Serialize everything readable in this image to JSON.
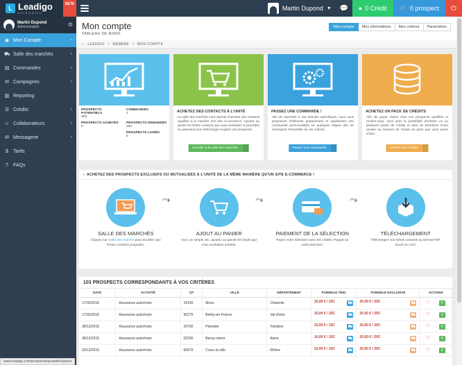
{
  "topbar": {
    "logo_text": "Leadigo",
    "logo_sub": "B to B & B to C",
    "beta": "BETA",
    "user_name": "Martin Dupond",
    "credit_label": "0 Crédit",
    "prospect_label": "0 prospect"
  },
  "sidebar": {
    "user_name": "Martin Dupond",
    "user_role": "Administration",
    "items": [
      {
        "label": "Mon Compte",
        "icon": "dashboard-icon",
        "glyph": "◉",
        "chevron": true
      },
      {
        "label": "Salle des marchés",
        "icon": "cart-icon",
        "glyph": "⛟",
        "chevron": true
      },
      {
        "label": "Commandes",
        "icon": "file-icon",
        "glyph": "▤",
        "chevron": true
      },
      {
        "label": "Campagnes",
        "icon": "mail-icon",
        "glyph": "✉",
        "chevron": true
      },
      {
        "label": "Reporting",
        "icon": "chart-icon",
        "glyph": "▥",
        "chevron": false
      },
      {
        "label": "Crédits",
        "icon": "list-icon",
        "glyph": "☰",
        "chevron": true
      },
      {
        "label": "Collaborateurs",
        "icon": "users-icon",
        "glyph": "☺",
        "chevron": true
      },
      {
        "label": "Messagerie",
        "icon": "envelope-icon",
        "glyph": "✉",
        "chevron": true
      },
      {
        "label": "Tarifs",
        "icon": "tag-icon",
        "glyph": "$",
        "chevron": false
      },
      {
        "label": "FAQs",
        "icon": "question-icon",
        "glyph": "?",
        "chevron": false
      }
    ]
  },
  "header": {
    "title": "Mon compte",
    "subtitle": "TABLEAU DE BORD",
    "tabs": [
      "Mon compte",
      "Mes informations",
      "Mes critères",
      "Paramètres"
    ]
  },
  "breadcrumb": [
    "LEADIGO",
    "MEMBRE",
    "MON COMPTE"
  ],
  "stats": {
    "labels": [
      "PROSPECTS POTENTIELS",
      "COMMANDES",
      "PROSPECTS ACHETÉS",
      "PROSPECTS DEMANDÉS",
      "PROSPECTS LIVRÉS"
    ],
    "values": [
      "103",
      "1",
      "0",
      "150",
      "0"
    ]
  },
  "cards": [
    {
      "title": "ACHETEZ DES CONTACTS À L'UNITÉ",
      "text": "La salle des marchés vous permet d'acheter des contacts qualifiés à la manière d'un site e-commerce. Ajoutez au panier les fiches contacts que vous souhaitez et procédez au paiement pour télécharger et gérer vos prospects.",
      "button": "Accéder à la salle des marchés",
      "color": "#5cb85c"
    },
    {
      "title": "PASSEZ UNE COMMANDE !",
      "text": "Afin de répondre à vos besoins spécifiques, nous vous proposons d'effectuer gratuitement et rapidement une commande personnalisée en quelques étapes afin de renseigner l'ensemble de vos critères.",
      "button": "Passer une commande",
      "color": "#3aa2dc"
    },
    {
      "title": "ACHETEZ UN PACK DE CRÉDITS",
      "text": "Afin de payer moins cher vos prospects qualifiés et rendez-vous, vous avez la possibilité d'acheter un ou plusieurs packs de crédits et ainsi de bénéficier d'une remise au moment de l'achat du pack que vous aurez choisi.",
      "button": "Acheter des crédits",
      "color": "#f0ad4e"
    }
  ],
  "process": {
    "title": "ACHETEZ DES PROSPECTS EXCLUSIFS OU MUTUALISÉS À L'UNITÉ DE LA MÊME MANIÈRE QU'UN SITE E-COMMERCE !",
    "steps": [
      {
        "title": "SALLE DES MARCHÉS",
        "pre": "Cliquez sur ",
        "link": "Salle des marché",
        "text": " pour accéder aux fiches contacts proposés."
      },
      {
        "title": "AJOUT AU PANIER",
        "pre": "",
        "link": "",
        "text": "Avec un simple clic, ajoutez au panier les leads que vous souhaitez acheter."
      },
      {
        "title": "PAIEMENT DE LA SÉLECTION",
        "pre": "",
        "link": "",
        "text": "Payez votre sélection avec les crédits, Paypal ou carte bancaire."
      },
      {
        "title": "TÉLÉCHARGEMENT",
        "pre": "",
        "link": "",
        "text": "Téléchargez vos fiches contacts au format PDF, Excel ou CSV."
      }
    ]
  },
  "table": {
    "title": "103 PROSPECTS CORRESPONDANTS À VOS CRITÈRES",
    "headers": [
      "DATE",
      "ACTIVITÉ",
      "CP",
      "VILLE",
      "DÉPARTEMENT",
      "FORMULE TRIO",
      "FORMULE EXCLUSIVE",
      "ACTIONS"
    ],
    "rows": [
      [
        "17/02/2016",
        "Assurance auto/moto",
        "16140",
        "Mons",
        "Charente",
        "10,00 € / 10C",
        "20,00 € / 20C"
      ],
      [
        "17/02/2016",
        "Assurance auto/moto",
        "95270",
        "Belloy-en-France",
        "Val-d'oise",
        "10,00 € / 10C",
        "20,00 € / 20C"
      ],
      [
        "28/12/2015",
        "Assurance auto/moto",
        "29700",
        "Plomelin",
        "Finistère",
        "10,00 € / 10C",
        "20,00 € / 20C"
      ],
      [
        "28/12/2015",
        "Assurance auto/moto",
        "02290",
        "Berny-riviere",
        "Aisne",
        "10,00 € / 10C",
        "20,00 € / 20C"
      ],
      [
        "29/12/2015",
        "Assurance auto/moto",
        "69470",
        "Cours la ville",
        "Rhône",
        "10,00 € / 10C",
        "20,00 € / 20C"
      ]
    ]
  },
  "status_url": "www.leadigo.com/prospects/quotation/packs"
}
